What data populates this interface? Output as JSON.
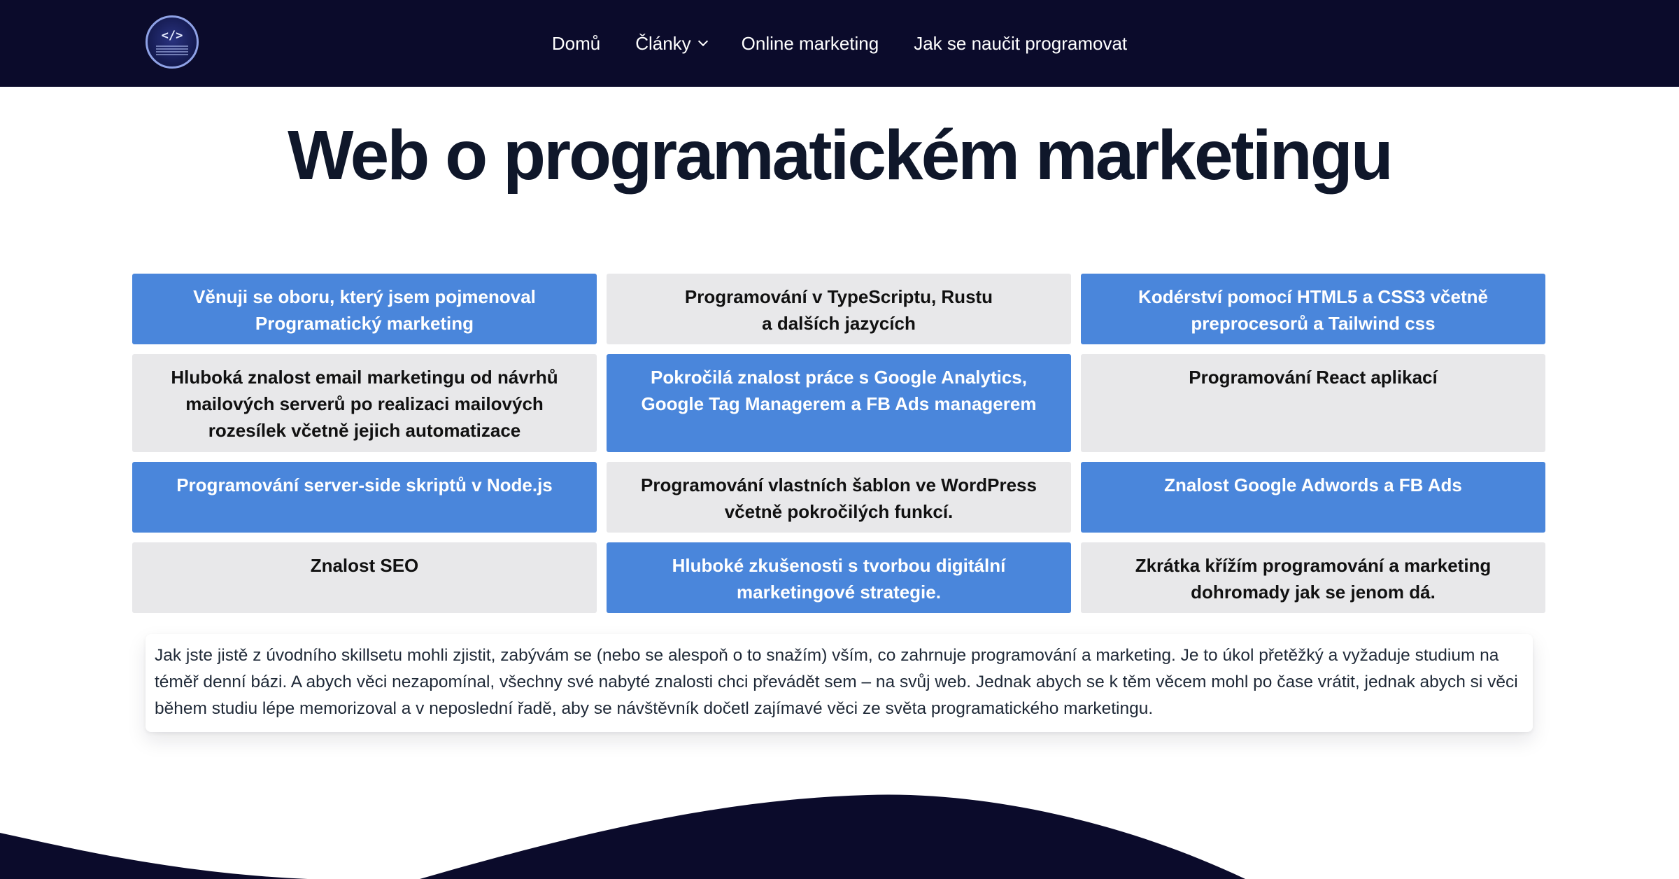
{
  "nav": {
    "logo_text": "</>",
    "links": [
      {
        "label": "Domů"
      },
      {
        "label": "Články"
      },
      {
        "label": "Online marketing"
      },
      {
        "label": "Jak se naučit programovat"
      }
    ]
  },
  "hero": {
    "title": "Web o programatickém marketingu"
  },
  "skills": [
    "Věnuji se oboru, který jsem pojmenoval Programatický marketing",
    "Programování v TypeScriptu, Rustu\na dalších jazycích",
    "Kodérství pomocí HTML5 a CSS3 včetně preprocesorů a Tailwind css",
    "Hluboká znalost email marketingu od návrhů mailových serverů po realizaci mailových rozesílek včetně jejich automatizace",
    "Pokročilá znalost práce s Google Analytics, Google Tag Managerem a FB Ads managerem",
    "Programování React aplikací",
    "Programování server-side skriptů v Node.js",
    "Programování vlastních šablon ve WordPress včetně pokročilých funkcí.",
    "Znalost Google Adwords a FB Ads",
    "Znalost SEO",
    "Hluboké zkušenosti s tvorbou digitální marketingové strategie.",
    "Zkrátka křížím programování a marketing dohromady jak se jenom dá."
  ],
  "intro": {
    "text": "Jak jste jistě z úvodního skillsetu mohli zjistit, zabývám se (nebo se alespoň o to snažím) vším, co zahrnuje programování a marketing. Je to úkol přetěžký a vyžaduje studium na téměř denní bázi. A abych věci nezapomínal, všechny své nabyté znalosti chci převádět sem – na svůj web. Jednak abych se k těm věcem mohl po čase vrátit, jednak abych si věci během studiu lépe memorizoval a v neposlední řadě, aby se návštěvník dočetl zajímavé věci ze světa programatického marketingu."
  },
  "colors": {
    "nav_bg": "#0b0b2b",
    "blue_tile": "#4a86db",
    "gray_tile": "#e8e8ea",
    "title": "#0f172a"
  }
}
